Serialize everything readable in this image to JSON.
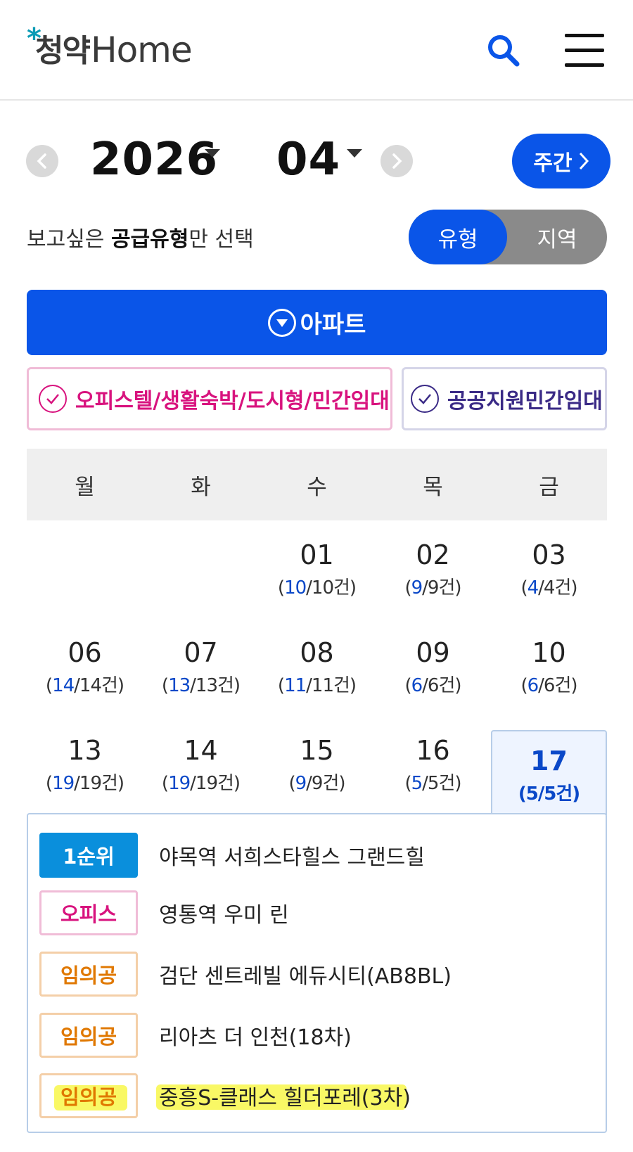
{
  "header": {
    "logo_star": "*",
    "logo_ko": "청약",
    "logo_en": "Home",
    "search_icon": "search-icon",
    "menu_icon": "hamburger-menu-icon"
  },
  "date_nav": {
    "year": "2026",
    "month": "04",
    "week_button": "주간",
    "prev_icon": "chevron-left-icon",
    "next_icon": "chevron-right-icon"
  },
  "filter": {
    "text_prefix": "보고싶은 ",
    "text_bold": "공급유형",
    "text_suffix": "만 선택",
    "toggle_on": "유형",
    "toggle_off": "지역"
  },
  "apartment_bar": {
    "label": "아파트"
  },
  "chips": [
    {
      "label": "오피스텔/생활숙박/도시형/민간임대"
    },
    {
      "label": "공공지원민간임대"
    }
  ],
  "weekdays": [
    "월",
    "화",
    "수",
    "목",
    "금"
  ],
  "days": [
    {
      "num": "01",
      "cnt_a": "10",
      "cnt_b": "/10건)"
    },
    {
      "num": "02",
      "cnt_a": "9",
      "cnt_b": "/9건)"
    },
    {
      "num": "03",
      "cnt_a": "4",
      "cnt_b": "/4건)"
    },
    {
      "num": "06",
      "cnt_a": "14",
      "cnt_b": "/14건)"
    },
    {
      "num": "07",
      "cnt_a": "13",
      "cnt_b": "/13건)"
    },
    {
      "num": "08",
      "cnt_a": "11",
      "cnt_b": "/11건)"
    },
    {
      "num": "09",
      "cnt_a": "6",
      "cnt_b": "/6건)"
    },
    {
      "num": "10",
      "cnt_a": "6",
      "cnt_b": "/6건)"
    },
    {
      "num": "13",
      "cnt_a": "19",
      "cnt_b": "/19건)"
    },
    {
      "num": "14",
      "cnt_a": "19",
      "cnt_b": "/19건)"
    },
    {
      "num": "15",
      "cnt_a": "9",
      "cnt_b": "/9건)"
    },
    {
      "num": "16",
      "cnt_a": "5",
      "cnt_b": "/5건)"
    },
    {
      "num": "17",
      "cnt_a": "5",
      "cnt_b": "/5건)"
    }
  ],
  "open_paren": "(",
  "listings": [
    {
      "badge": "1순위",
      "title": "야목역 서희스타힐스 그랜드힐"
    },
    {
      "badge": "오피스",
      "title": "영통역 우미 린"
    },
    {
      "badge": "임의공",
      "title": "검단 센트레빌 에듀시티(AB8BL)"
    },
    {
      "badge": "임의공",
      "title": "리아츠 더 인천(18차)"
    },
    {
      "badge": "임의공",
      "title": "중흥S-클래스 힐더포레(3차)"
    }
  ],
  "colors": {
    "primary": "#0a55e8",
    "badge_blue": "#0a8fdc",
    "pink": "#d8137e",
    "orange": "#e07800",
    "purple": "#3a2a86",
    "highlight": "#f8f74a"
  }
}
